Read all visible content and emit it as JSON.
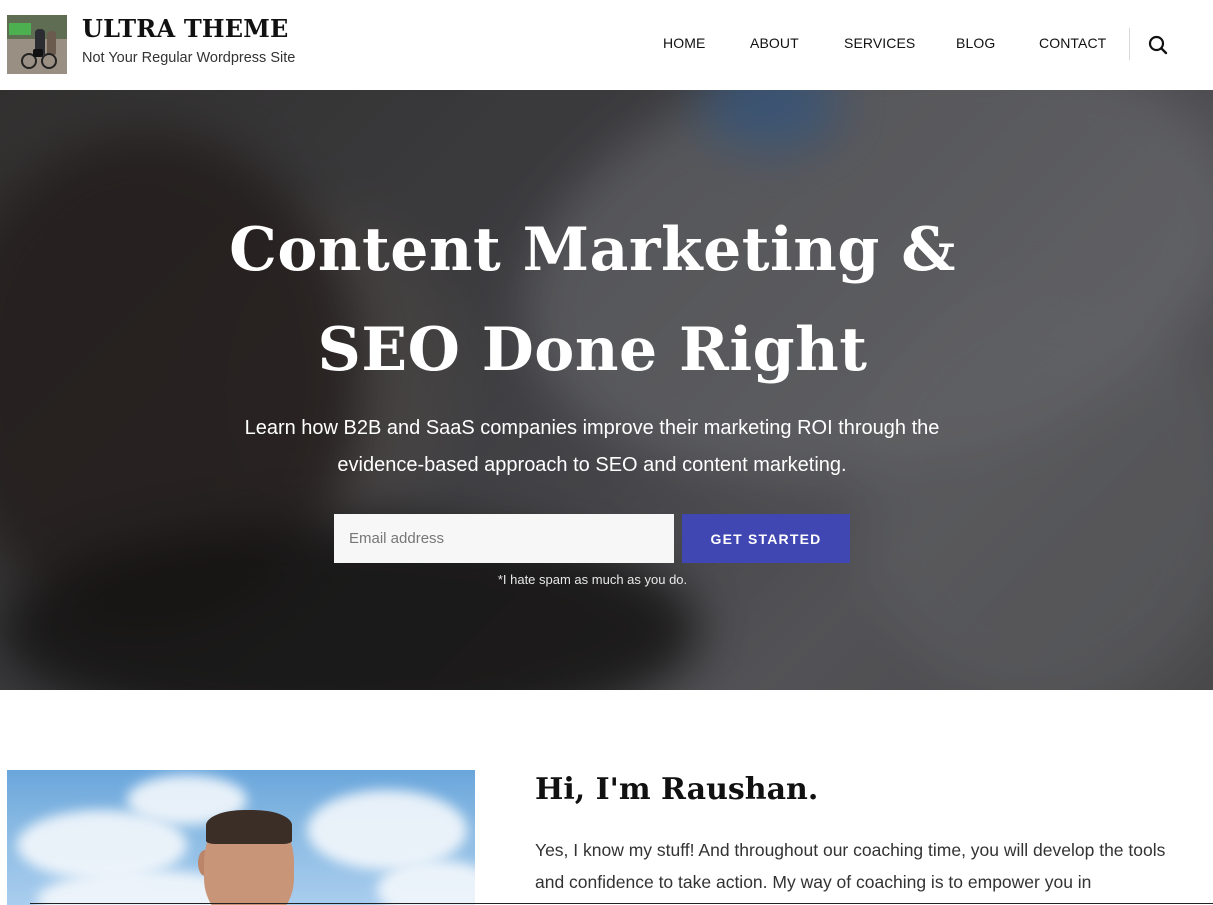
{
  "header": {
    "site_title": "ULTRA THEME",
    "tagline": "Not Your Regular Wordpress Site",
    "nav": [
      {
        "label": "HOME"
      },
      {
        "label": "ABOUT"
      },
      {
        "label": "SERVICES"
      },
      {
        "label": "BLOG"
      },
      {
        "label": "CONTACT"
      }
    ],
    "search_icon": "search-icon"
  },
  "hero": {
    "title_line1": "Content Marketing &",
    "title_line2": "SEO Done Right",
    "subtitle": "Learn how B2B and SaaS companies improve their marketing ROI through the evidence-based approach to SEO and content marketing.",
    "email_placeholder": "Email address",
    "cta_label": "GET STARTED",
    "spam_note": "*I hate spam as much as you do."
  },
  "about": {
    "heading": "Hi, I'm Raushan.",
    "text": "Yes, I know my stuff! And throughout our coaching time, you will develop the tools and confidence to take action. My way of coaching is to empower you in"
  },
  "colors": {
    "accent": "#4046b2",
    "text_dark": "#111111",
    "text_body": "#333333"
  }
}
